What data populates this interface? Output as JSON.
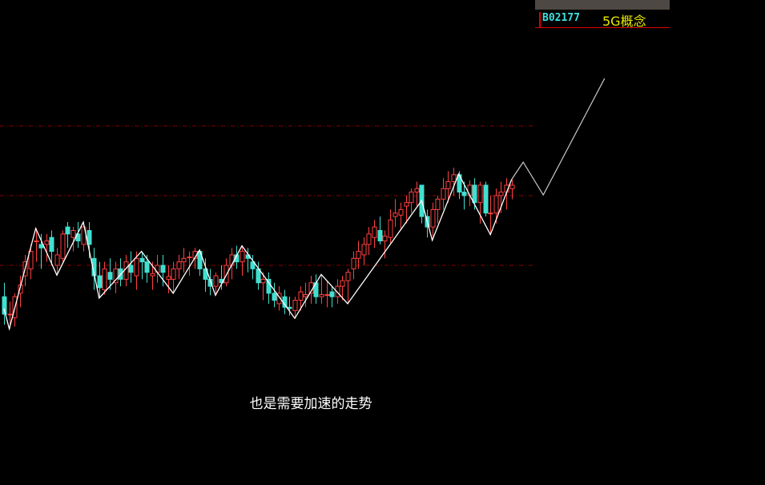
{
  "header": {
    "code": "B02177",
    "block_name": "5G概念"
  },
  "caption": "也是需要加速的走势",
  "colors": {
    "up": "#ff4040",
    "down": "#40e0d0",
    "zigzag": "#ffffff",
    "projection": "#c8c8c8",
    "level": "#8b0000",
    "header_bar": "#4d4843"
  },
  "chart_data": {
    "type": "candlestick",
    "title": "",
    "levels": [
      10.0,
      11.0,
      12.0
    ],
    "ylim": [
      8.2,
      12.9
    ],
    "candles": [
      [
        9.55,
        9.75,
        9.15,
        9.3
      ],
      [
        9.3,
        9.48,
        9.09,
        9.3
      ],
      [
        9.25,
        9.6,
        9.12,
        9.55
      ],
      [
        9.6,
        9.85,
        9.4,
        9.72
      ],
      [
        9.85,
        10.15,
        9.7,
        10.05
      ],
      [
        9.95,
        10.3,
        9.8,
        10.2
      ],
      [
        10.35,
        10.53,
        10.05,
        10.35
      ],
      [
        10.3,
        10.45,
        9.95,
        10.25
      ],
      [
        10.3,
        10.45,
        10.05,
        10.35
      ],
      [
        10.4,
        10.5,
        10.0,
        10.2
      ],
      [
        10.0,
        10.25,
        9.86,
        10.15
      ],
      [
        10.1,
        10.5,
        10.05,
        10.45
      ],
      [
        10.55,
        10.62,
        10.25,
        10.45
      ],
      [
        10.4,
        10.55,
        10.2,
        10.5
      ],
      [
        10.45,
        10.62,
        10.25,
        10.35
      ],
      [
        10.3,
        10.62,
        10.2,
        10.55
      ],
      [
        10.5,
        10.62,
        10.1,
        10.3
      ],
      [
        10.1,
        10.25,
        9.65,
        9.85
      ],
      [
        9.85,
        10.05,
        9.53,
        9.68
      ],
      [
        9.65,
        10.05,
        9.58,
        9.95
      ],
      [
        9.9,
        10.1,
        9.65,
        9.8
      ],
      [
        9.75,
        10.05,
        9.6,
        9.95
      ],
      [
        9.95,
        10.1,
        9.7,
        9.8
      ],
      [
        9.8,
        10.15,
        9.7,
        10.05
      ],
      [
        10.0,
        10.2,
        9.75,
        9.9
      ],
      [
        9.85,
        10.2,
        9.65,
        10.1
      ],
      [
        10.1,
        10.2,
        9.8,
        10.05
      ],
      [
        10.05,
        10.15,
        9.75,
        9.9
      ],
      [
        9.85,
        10.05,
        9.65,
        9.88
      ],
      [
        9.9,
        10.15,
        9.75,
        10.0
      ],
      [
        10.0,
        10.15,
        9.7,
        9.9
      ],
      [
        9.8,
        10.0,
        9.6,
        9.84
      ],
      [
        9.8,
        10.05,
        9.6,
        9.95
      ],
      [
        9.95,
        10.15,
        9.8,
        10.05
      ],
      [
        10.05,
        10.25,
        9.9,
        10.1
      ],
      [
        10.12,
        10.2,
        9.85,
        10.12
      ],
      [
        10.1,
        10.25,
        9.95,
        10.2
      ],
      [
        10.2,
        10.22,
        9.85,
        9.95
      ],
      [
        9.95,
        10.1,
        9.62,
        9.8
      ],
      [
        9.8,
        9.95,
        9.57,
        9.7
      ],
      [
        9.7,
        9.9,
        9.57,
        9.85
      ],
      [
        9.8,
        10.0,
        9.65,
        9.75
      ],
      [
        9.75,
        10.1,
        9.7,
        10.0
      ],
      [
        10.0,
        10.25,
        9.8,
        10.15
      ],
      [
        10.15,
        10.28,
        9.95,
        10.05
      ],
      [
        10.05,
        10.28,
        9.85,
        10.2
      ],
      [
        10.15,
        10.25,
        9.9,
        10.1
      ],
      [
        10.05,
        10.15,
        9.8,
        9.95
      ],
      [
        9.95,
        10.05,
        9.65,
        9.75
      ],
      [
        9.75,
        9.9,
        9.5,
        9.8
      ],
      [
        9.8,
        9.9,
        9.45,
        9.6
      ],
      [
        9.6,
        9.75,
        9.4,
        9.5
      ],
      [
        9.45,
        9.7,
        9.35,
        9.6
      ],
      [
        9.55,
        9.65,
        9.3,
        9.4
      ],
      [
        9.4,
        9.55,
        9.28,
        9.38
      ],
      [
        9.35,
        9.55,
        9.24,
        9.5
      ],
      [
        9.5,
        9.7,
        9.35,
        9.62
      ],
      [
        9.55,
        9.75,
        9.4,
        9.58
      ],
      [
        9.6,
        9.85,
        9.45,
        9.75
      ],
      [
        9.75,
        9.87,
        9.45,
        9.55
      ],
      [
        9.55,
        9.87,
        9.45,
        9.58
      ],
      [
        9.58,
        9.78,
        9.4,
        9.58
      ],
      [
        9.62,
        9.7,
        9.4,
        9.55
      ],
      [
        9.55,
        9.8,
        9.45,
        9.7
      ],
      [
        9.7,
        9.85,
        9.5,
        9.78
      ],
      [
        9.78,
        9.95,
        9.45,
        9.9
      ],
      [
        9.95,
        10.2,
        9.8,
        10.1
      ],
      [
        10.1,
        10.35,
        9.95,
        10.2
      ],
      [
        10.15,
        10.4,
        10.0,
        10.3
      ],
      [
        10.3,
        10.55,
        10.15,
        10.45
      ],
      [
        10.4,
        10.65,
        10.25,
        10.55
      ],
      [
        10.5,
        10.7,
        10.3,
        10.35
      ],
      [
        10.35,
        10.5,
        10.1,
        10.42
      ],
      [
        10.4,
        10.8,
        10.3,
        10.65
      ],
      [
        10.7,
        10.95,
        10.55,
        10.75
      ],
      [
        10.72,
        10.9,
        10.5,
        10.8
      ],
      [
        10.85,
        11.0,
        10.6,
        10.9
      ],
      [
        10.9,
        11.1,
        10.75,
        11.05
      ],
      [
        11.05,
        11.2,
        10.85,
        11.1
      ],
      [
        11.15,
        11.15,
        10.6,
        10.7
      ],
      [
        10.7,
        10.8,
        10.4,
        10.55
      ],
      [
        10.55,
        10.9,
        10.36,
        10.8
      ],
      [
        10.8,
        11.0,
        10.6,
        10.95
      ],
      [
        10.95,
        11.25,
        10.8,
        11.1
      ],
      [
        11.1,
        11.35,
        10.9,
        11.2
      ],
      [
        11.2,
        11.4,
        11.0,
        11.3
      ],
      [
        11.3,
        11.35,
        10.95,
        11.05
      ],
      [
        11.05,
        11.2,
        10.8,
        11.0
      ],
      [
        11.0,
        11.22,
        10.85,
        11.15
      ],
      [
        11.15,
        11.25,
        10.8,
        10.9
      ],
      [
        10.9,
        11.2,
        10.6,
        11.15
      ],
      [
        11.15,
        11.2,
        10.7,
        10.75
      ],
      [
        10.75,
        11.0,
        10.44,
        10.75
      ],
      [
        10.75,
        11.1,
        10.6,
        11.0
      ],
      [
        11.0,
        11.2,
        10.75,
        11.05
      ],
      [
        11.05,
        11.25,
        10.8,
        11.15
      ],
      [
        11.1,
        11.23,
        10.95,
        11.15
      ]
    ],
    "zigzag": [
      [
        0,
        9.38
      ],
      [
        1,
        9.09
      ],
      [
        6,
        10.53
      ],
      [
        10,
        9.86
      ],
      [
        15,
        10.62
      ],
      [
        18,
        9.53
      ],
      [
        26,
        10.2
      ],
      [
        32,
        9.6
      ],
      [
        37,
        10.22
      ],
      [
        40,
        9.57
      ],
      [
        45,
        10.28
      ],
      [
        55,
        9.24
      ],
      [
        60,
        9.87
      ],
      [
        65,
        9.45
      ],
      [
        79,
        10.93
      ],
      [
        81,
        10.36
      ],
      [
        86,
        11.31
      ],
      [
        92,
        10.44
      ],
      [
        96,
        11.23
      ]
    ],
    "projection": [
      [
        96,
        11.23
      ],
      [
        98.2,
        11.48
      ],
      [
        102,
        11.01
      ],
      [
        113.6,
        12.68
      ]
    ]
  }
}
